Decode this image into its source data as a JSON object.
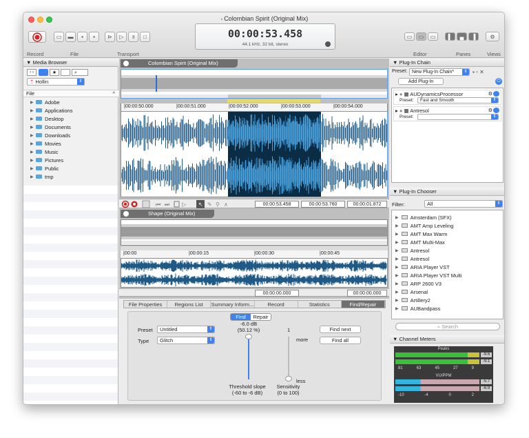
{
  "window": {
    "title": "Colombian Spirit (Original Mix)"
  },
  "toolbar": {
    "labels": {
      "record": "Record",
      "file": "File",
      "transport": "Transport",
      "editor": "Editor",
      "panes": "Panes",
      "views": "Views"
    }
  },
  "transport": {
    "time": "00:00:53.458",
    "format": "44.1 kHz, 32 bit, stereo"
  },
  "media_browser": {
    "header": "Media Browser",
    "location": "Hollin",
    "column": "File",
    "folders": [
      "Adobe",
      "Applications",
      "Desktop",
      "Documents",
      "Downloads",
      "Movies",
      "Music",
      "Pictures",
      "Public",
      "tmp"
    ]
  },
  "editor_top": {
    "tab": "Colombian Spirit (Original Mix)",
    "ruler": [
      "|00:00:50.000",
      "|00:00:51.000",
      "|00:00:52.000",
      "|00:00:53.000",
      "|00:00:54.000"
    ],
    "times": [
      "00:00:53.458",
      "00:00:53.760",
      "00:00:01.872"
    ]
  },
  "editor_bottom": {
    "tab": "Shape (Original Mix)",
    "ruler": [
      "|00:00",
      "|00:00:15",
      "|00:00:30",
      "|00:00:45"
    ],
    "times": [
      "00:00:00.000",
      "00:00:00.000"
    ]
  },
  "tabs": [
    "File Properties",
    "Regions List",
    "Summary Inform...",
    "Record",
    "Statistics",
    "Find/Repair"
  ],
  "find_repair": {
    "seg_find": "Find",
    "seg_repair": "Repair",
    "preset_label": "Preset",
    "preset_value": "Untitled",
    "type_label": "Type",
    "type_value": "Glitch",
    "slope_value": "-6.0 dB",
    "slope_value2": "(50.12 %)",
    "sens_value": "1",
    "more": "more",
    "less": "less",
    "slope_label": "Threshold slope",
    "slope_range": "(-60 to -6 dB)",
    "sens_label": "Sensitivity",
    "sens_range": "(0 to 100)",
    "find_next": "Find next",
    "find_all": "Find all"
  },
  "plugin_chain": {
    "header": "Plug-In Chain",
    "preset_label": "Preset:",
    "preset_value": "New Plug-In Chain*",
    "add": "Add Plug-In",
    "plugins": [
      {
        "name": "AUDynamicsProcessor",
        "preset_label": "Preset:",
        "preset": "Fast and Smooth"
      },
      {
        "name": "Antresol",
        "preset_label": "Preset:",
        "preset": ""
      }
    ]
  },
  "plugin_chooser": {
    "header": "Plug-In Chooser",
    "filter_label": "Filter:",
    "filter_value": "All",
    "items": [
      "Amsterdam (SFX)",
      "AMT Amp Leveling",
      "AMT Max Warm",
      "AMT Multi-Max",
      "Antresol",
      "Antresol",
      "ARIA Player VST",
      "ARIA Player VST Multi",
      "ARP 2600 V3",
      "Arsenal",
      "Artillery2",
      "AUBandpass"
    ],
    "search_placeholder": "Search"
  },
  "channel_meters": {
    "header": "Channel Meters",
    "peaks_label": "Peaks",
    "peak_values": [
      "-9.6",
      "-9.1"
    ],
    "peak_scale": [
      "81",
      "63",
      "45",
      "27",
      "9"
    ],
    "vu_label": "VU/PPM",
    "vu_values": [
      "-5.7",
      "-6.9"
    ],
    "vu_scale": [
      "-10",
      "-4",
      "0",
      "2"
    ]
  }
}
